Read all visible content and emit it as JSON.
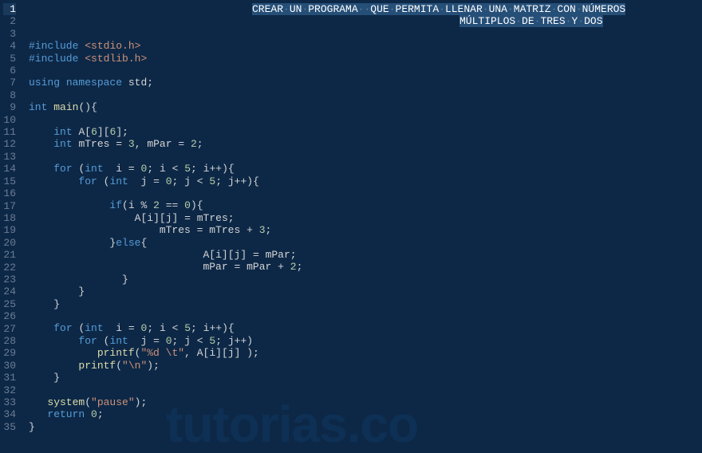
{
  "editor": {
    "line_count": 35,
    "current_line": 1,
    "selected_comment_line1": "CREAR UN PROGRAMA  QUE PERMITA LLENAR UNA MATRIZ CON NÚMEROS",
    "selected_comment_line2": "MÚLTIPLOS DE TRES Y DOS",
    "watermark": "tutorias.co",
    "lines": [
      {
        "n": 1,
        "content": ""
      },
      {
        "n": 2,
        "content": ""
      },
      {
        "n": 3,
        "content": ""
      },
      {
        "n": 4,
        "raw": "#include <stdio.h>"
      },
      {
        "n": 5,
        "raw": "#include <stdlib.h>"
      },
      {
        "n": 6,
        "content": ""
      },
      {
        "n": 7,
        "raw": "using namespace std;"
      },
      {
        "n": 8,
        "content": ""
      },
      {
        "n": 9,
        "raw": "int main(){"
      },
      {
        "n": 10,
        "content": ""
      },
      {
        "n": 11,
        "raw": "    int A[6][6];"
      },
      {
        "n": 12,
        "raw": "    int mTres = 3, mPar = 2;"
      },
      {
        "n": 13,
        "content": ""
      },
      {
        "n": 14,
        "raw": "    for (int  i = 0; i < 5; i++){"
      },
      {
        "n": 15,
        "raw": "        for (int  j = 0; j < 5; j++){"
      },
      {
        "n": 16,
        "content": ""
      },
      {
        "n": 17,
        "raw": "             if(i % 2 == 0){"
      },
      {
        "n": 18,
        "raw": "                 A[i][j] = mTres;"
      },
      {
        "n": 19,
        "raw": "                     mTres = mTres + 3;"
      },
      {
        "n": 20,
        "raw": "             }else{"
      },
      {
        "n": 21,
        "raw": "                            A[i][j] = mPar;"
      },
      {
        "n": 22,
        "raw": "                            mPar = mPar + 2;"
      },
      {
        "n": 23,
        "raw": "               }"
      },
      {
        "n": 24,
        "raw": "        }"
      },
      {
        "n": 25,
        "raw": "    }"
      },
      {
        "n": 26,
        "content": ""
      },
      {
        "n": 27,
        "raw": "    for (int  i = 0; i < 5; i++){"
      },
      {
        "n": 28,
        "raw": "        for (int  j = 0; j < 5; j++)"
      },
      {
        "n": 29,
        "raw": "           printf(\"%d \\t\", A[i][j] );"
      },
      {
        "n": 30,
        "raw": "        printf(\"\\n\");"
      },
      {
        "n": 31,
        "raw": "    }"
      },
      {
        "n": 32,
        "content": ""
      },
      {
        "n": 33,
        "raw": "   system(\"pause\");"
      },
      {
        "n": 34,
        "raw": "   return 0;"
      },
      {
        "n": 35,
        "raw": "}"
      }
    ]
  }
}
